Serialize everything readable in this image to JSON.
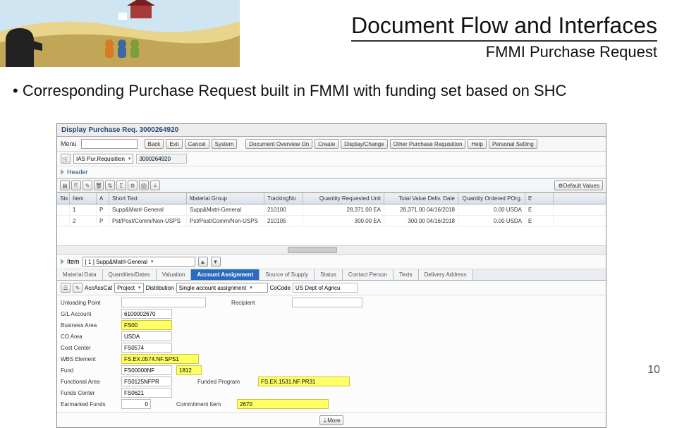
{
  "slide": {
    "title": "Document Flow and Interfaces",
    "subtitle": "FMMI Purchase Request",
    "bullet": "• Corresponding Purchase Request built in FMMI with funding set based on SHC",
    "page_number": "10"
  },
  "app": {
    "window_title": "Display Purchase Req. 3000264920",
    "menu_label": "Menu",
    "back": "Back",
    "exit": "Exit",
    "cancel": "Cancel",
    "system": "System",
    "doc_overview": "Document Overview On",
    "create": "Create",
    "display_change": "Display/Change",
    "other_pr": "Other Purchase Requisition",
    "help": "Help",
    "personal_setting": "Personal Setting",
    "pr_type": "IAS Pur.Requisition",
    "pr_number": "3000264920",
    "header_link": "Header",
    "default_values": "Default Values",
    "item_label": "Item",
    "item_selected": "[ 1 ] Supp&Matrl-General",
    "more_label": "More",
    "toolbar": {
      "acc_cat": "AccAssCat",
      "acc_cat_val": "Project",
      "dist_label": "Distribution",
      "dist_val": "Single account assignment",
      "cocode_label": "CoCode",
      "cocode_val": "US Dept of Agricu"
    },
    "tabs": {
      "material": "Material Data",
      "quantities": "Quantities/Dates",
      "valuation": "Valuation",
      "account": "Account Assignment",
      "source": "Source of Supply",
      "status": "Status",
      "contact": "Contact Person",
      "texts": "Texts",
      "delivery": "Delivery Address"
    }
  },
  "grid": {
    "cols": {
      "sel": "Sts",
      "item": "Item",
      "a": "A",
      "short_text": "Short Text",
      "material_group": "Material Group",
      "tracking": "TrackingNo",
      "qty": "Quantity Requested Unit",
      "total_value": "Total Value Deliv. Date",
      "qty_ordered": "Quantity Ordered POrg.",
      "porg": "E"
    },
    "rows": [
      {
        "item": "1",
        "a": "P",
        "short_text": "Supp&Matrl-General",
        "material_group": "Supp&Matrl-General",
        "tracking": "210100",
        "qty": "28,371.00 EA",
        "total_value": "28,371.00 04/16/2018",
        "qty_ordered": "0.00 USDA",
        "porg": "E"
      },
      {
        "item": "2",
        "a": "P",
        "short_text": "Pst/Post/Comm/Non-USPS",
        "material_group": "Pst/Post/Comm/Non-USPS",
        "tracking": "210105",
        "qty": "300.00 EA",
        "total_value": "300.00 04/16/2018",
        "qty_ordered": "0.00 USDA",
        "porg": "E"
      }
    ]
  },
  "acc": {
    "unloading_point": {
      "label": "Unloading Point",
      "value": ""
    },
    "recipient": {
      "label": "Recipient",
      "value": ""
    },
    "gl_account": {
      "label": "G/L Account",
      "value": "6100002670"
    },
    "business_area": {
      "label": "Business Area",
      "value": "FS00"
    },
    "co_area": {
      "label": "CO Area",
      "value": "USDA"
    },
    "cost_center": {
      "label": "Cost Center",
      "value": "FS0574"
    },
    "wbs_element": {
      "label": "WBS Element",
      "value": "FS.EX.0574.NF.SPS1"
    },
    "fund": {
      "label": "Fund",
      "value": "FS00000NF",
      "sub": "1812"
    },
    "functional_area": {
      "label": "Functional Area",
      "value": "FS0125NFPR"
    },
    "funded_program": {
      "label": "Funded Program",
      "value": "FS.EX.1531.NF.PR31"
    },
    "funds_center": {
      "label": "Funds Center",
      "value": "FS0621"
    },
    "earmarked_funds": {
      "label": "Earmarked Funds",
      "value": "0"
    },
    "commitment_item": {
      "label": "Commitment Item",
      "value": "2670"
    }
  }
}
